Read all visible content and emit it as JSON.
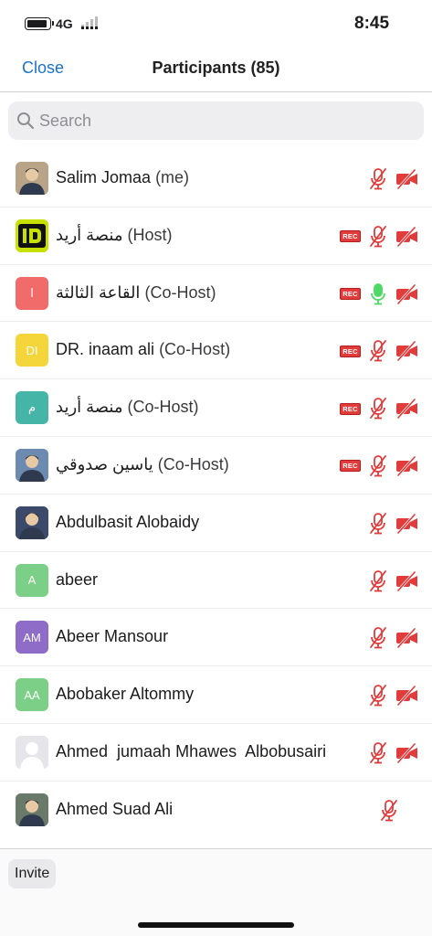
{
  "status_bar": {
    "network": "4G",
    "time": "8:45"
  },
  "nav": {
    "close_label": "Close",
    "title": "Participants (85)"
  },
  "search": {
    "placeholder": "Search",
    "icon": "magnifier-icon"
  },
  "colors": {
    "accent": "#1a73c9",
    "muted_red": "#e23b3b",
    "unmuted_green": "#4cd964"
  },
  "participants": [
    {
      "name": "Salim Jomaa",
      "role": "(me)",
      "avatar_type": "photo",
      "avatar_bg": "#b9a487",
      "initials": "",
      "rec": false,
      "mic": "muted",
      "video": "off"
    },
    {
      "name": "منصة أريد",
      "role": "(Host)",
      "avatar_type": "logo",
      "avatar_bg": "#c7e000",
      "initials": "",
      "rec": true,
      "mic": "muted",
      "video": "off"
    },
    {
      "name": "القاعة الثالثة",
      "role": "(Co-Host)",
      "avatar_type": "initials",
      "avatar_bg": "#f26b6b",
      "initials": "ا",
      "rec": true,
      "mic": "on",
      "video": "off"
    },
    {
      "name": "DR. inaam ali",
      "role": "(Co-Host)",
      "avatar_type": "initials",
      "avatar_bg": "#f5d63a",
      "initials": "DI",
      "rec": true,
      "mic": "muted",
      "video": "off"
    },
    {
      "name": "منصة أريد",
      "role": "(Co-Host)",
      "avatar_type": "initials",
      "avatar_bg": "#45b5a8",
      "initials": "م",
      "rec": true,
      "mic": "muted",
      "video": "off"
    },
    {
      "name": "ياسين صدوقي",
      "role": "(Co-Host)",
      "avatar_type": "photo",
      "avatar_bg": "#6d8bb0",
      "initials": "",
      "rec": true,
      "mic": "muted",
      "video": "off"
    },
    {
      "name": "Abdulbasit Alobaidy",
      "role": "",
      "avatar_type": "photo",
      "avatar_bg": "#3b4a6a",
      "initials": "",
      "rec": false,
      "mic": "muted",
      "video": "off"
    },
    {
      "name": "abeer",
      "role": "",
      "avatar_type": "initials",
      "avatar_bg": "#7ccf86",
      "initials": "A",
      "rec": false,
      "mic": "muted",
      "video": "off"
    },
    {
      "name": "Abeer Mansour",
      "role": "",
      "avatar_type": "initials",
      "avatar_bg": "#8e6cc7",
      "initials": "AM",
      "rec": false,
      "mic": "muted",
      "video": "off"
    },
    {
      "name": "Abobaker Altommy",
      "role": "",
      "avatar_type": "initials",
      "avatar_bg": "#7ccf86",
      "initials": "AA",
      "rec": false,
      "mic": "muted",
      "video": "off"
    },
    {
      "name": "Ahmed  jumaah Mhawes  Albobusairi",
      "role": "",
      "avatar_type": "placeholder",
      "avatar_bg": "#e6e6ea",
      "initials": "",
      "rec": false,
      "mic": "muted",
      "video": "off"
    },
    {
      "name": "Ahmed Suad Ali",
      "role": "",
      "avatar_type": "photo",
      "avatar_bg": "#6a7a6a",
      "initials": "",
      "rec": false,
      "mic": "muted",
      "video": "none"
    }
  ],
  "rec_label": "REC",
  "footer": {
    "invite_label": "Invite"
  }
}
